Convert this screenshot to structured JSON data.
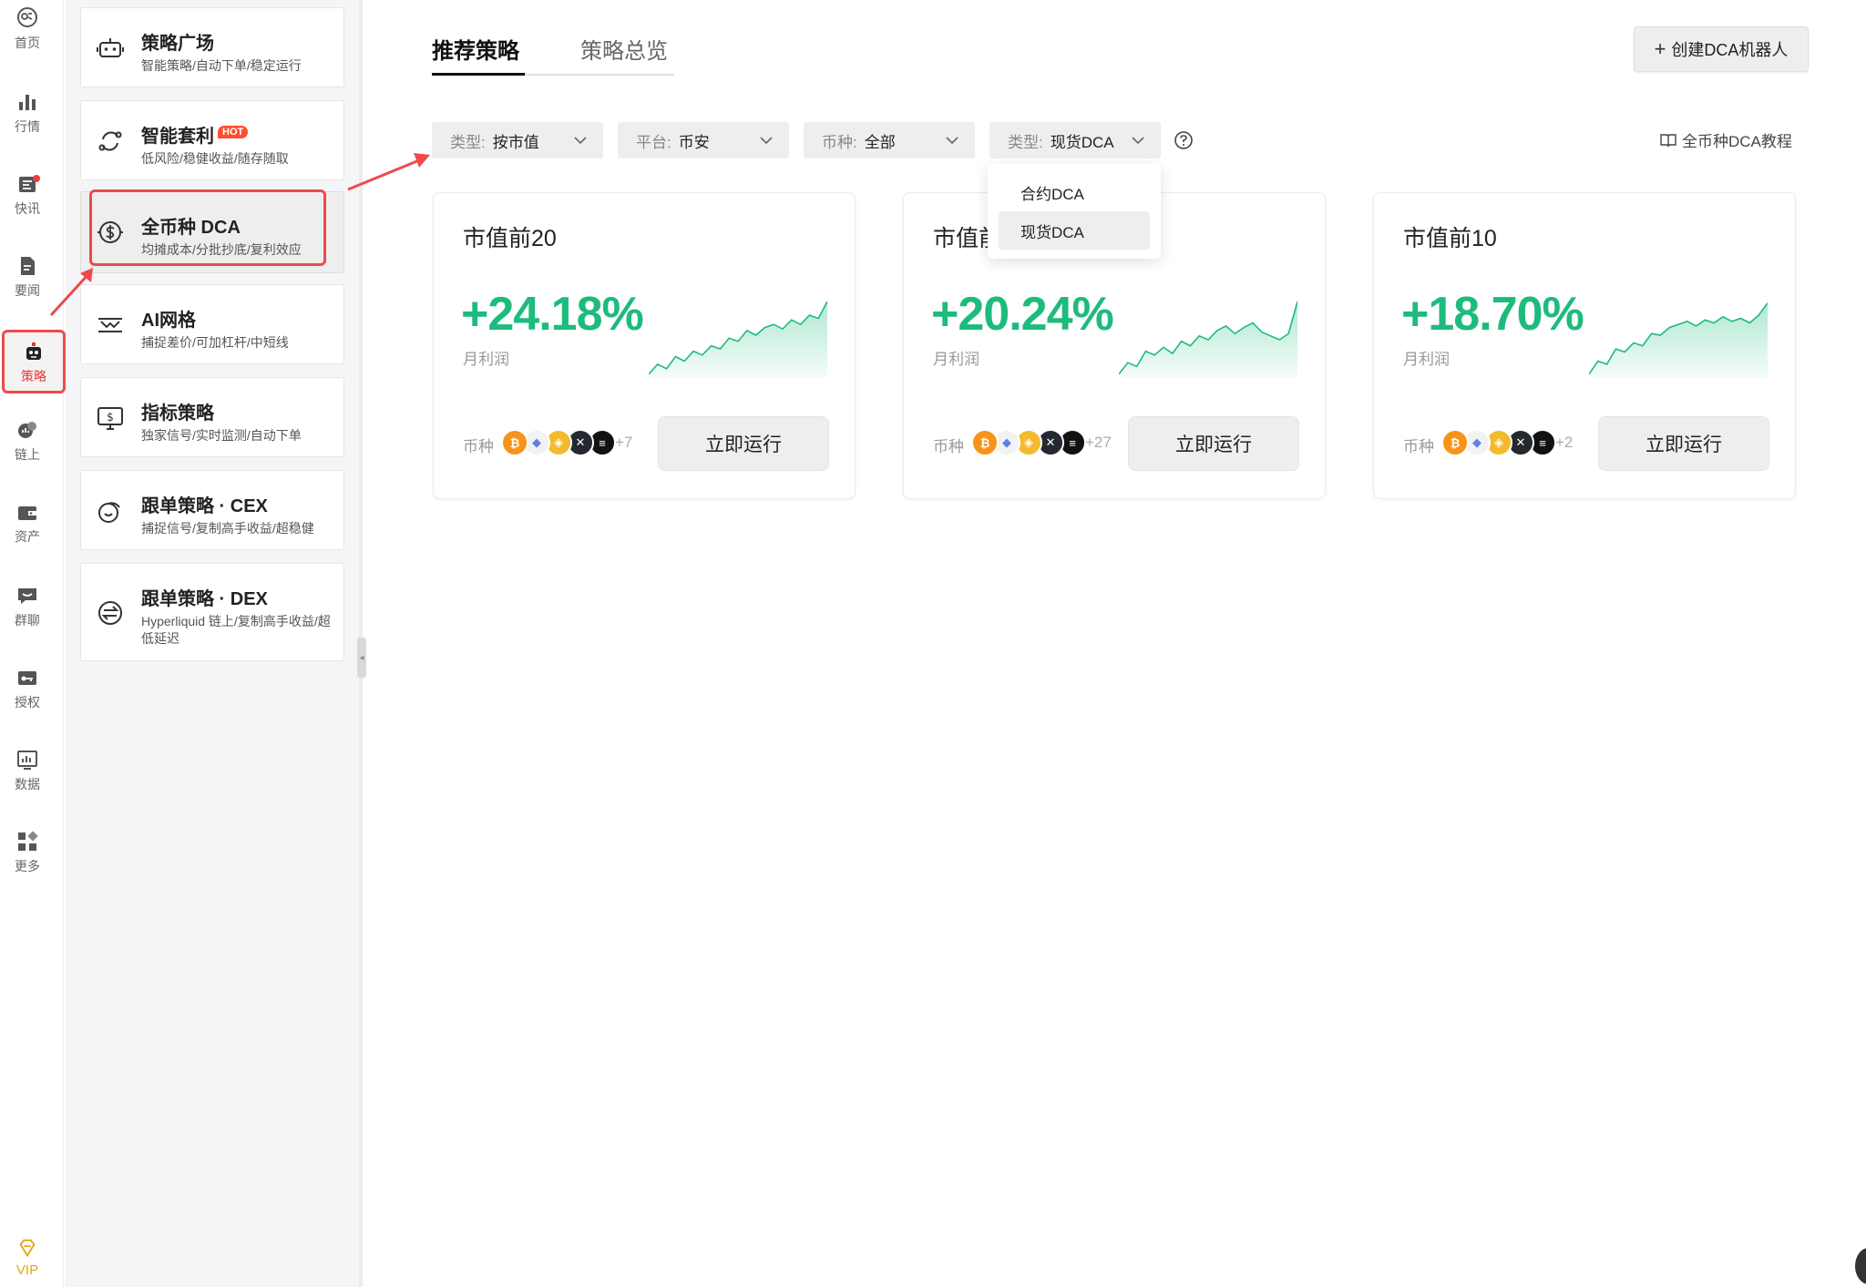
{
  "rail": {
    "items": [
      {
        "label": "首页",
        "icon": "home-icon"
      },
      {
        "label": "行情",
        "icon": "bar-chart-icon"
      },
      {
        "label": "快讯",
        "icon": "news-flash-icon"
      },
      {
        "label": "要闻",
        "icon": "document-icon"
      },
      {
        "label": "策略",
        "icon": "robot-icon"
      },
      {
        "label": "链上",
        "icon": "chain-icon"
      },
      {
        "label": "资产",
        "icon": "wallet-icon"
      },
      {
        "label": "群聊",
        "icon": "chat-icon"
      },
      {
        "label": "授权",
        "icon": "key-icon"
      },
      {
        "label": "数据",
        "icon": "data-icon"
      },
      {
        "label": "更多",
        "icon": "grid-icon"
      }
    ],
    "vip_label": "VIP",
    "active_index": 4
  },
  "strategies": [
    {
      "title": "策略广场",
      "subtitle": "智能策略/自动下单/稳定运行",
      "icon": "robot-icon"
    },
    {
      "title": "智能套利",
      "badge": "HOT",
      "subtitle": "低风险/稳健收益/随存随取",
      "icon": "loop-icon"
    },
    {
      "title": "全币种 DCA",
      "subtitle": "均摊成本/分批抄底/复利效应",
      "icon": "dca-icon"
    },
    {
      "title": "AI网格",
      "subtitle": "捕捉差价/可加杠杆/中短线",
      "icon": "grid-trade-icon"
    },
    {
      "title": "指标策略",
      "subtitle": "独家信号/实时监测/自动下单",
      "icon": "indicator-icon"
    },
    {
      "title": "跟单策略 · CEX",
      "subtitle": "捕捉信号/复制高手收益/超稳健",
      "icon": "copy-cex-icon"
    },
    {
      "title": "跟单策略 · DEX",
      "subtitle": "Hyperliquid 链上/复制高手收益/超低延迟",
      "icon": "copy-dex-icon"
    }
  ],
  "tabs": [
    {
      "label": "推荐策略",
      "active": true
    },
    {
      "label": "策略总览",
      "active": false
    }
  ],
  "create_button": "创建DCA机器人",
  "filters": [
    {
      "label": "类型:",
      "value": "按市值"
    },
    {
      "label": "平台:",
      "value": "币安"
    },
    {
      "label": "币种:",
      "value": "全部"
    },
    {
      "label": "类型:",
      "value": "现货DCA"
    }
  ],
  "tutorial_link": "全币种DCA教程",
  "dropdown": {
    "options": [
      "合约DCA",
      "现货DCA"
    ],
    "selected": "现货DCA"
  },
  "cards": [
    {
      "title": "市值前20",
      "profit": "+24.18%",
      "profit_label": "月利润",
      "coin_label": "币种",
      "more": "+7",
      "button": "立即运行",
      "spark": [
        0.05,
        0.18,
        0.12,
        0.28,
        0.22,
        0.35,
        0.3,
        0.42,
        0.38,
        0.52,
        0.48,
        0.62,
        0.56,
        0.66,
        0.7,
        0.64,
        0.76,
        0.7,
        0.82,
        0.78,
        1.0
      ]
    },
    {
      "title": "市值前",
      "profit": "+20.24%",
      "profit_label": "月利润",
      "coin_label": "币种",
      "more": "+27",
      "button": "立即运行",
      "spark": [
        0.05,
        0.2,
        0.15,
        0.35,
        0.3,
        0.4,
        0.32,
        0.48,
        0.42,
        0.55,
        0.5,
        0.62,
        0.68,
        0.58,
        0.66,
        0.72,
        0.6,
        0.55,
        0.5,
        0.58,
        1.0
      ]
    },
    {
      "title": "市值前10",
      "profit": "+18.70%",
      "profit_label": "月利润",
      "coin_label": "币种",
      "more": "+2",
      "button": "立即运行",
      "spark": [
        0.05,
        0.22,
        0.18,
        0.38,
        0.34,
        0.46,
        0.42,
        0.58,
        0.56,
        0.66,
        0.7,
        0.74,
        0.68,
        0.76,
        0.72,
        0.8,
        0.74,
        0.78,
        0.72,
        0.82,
        0.98
      ]
    }
  ],
  "coins": [
    {
      "name": "BTC",
      "symbol": "₿",
      "color": "#f7931a"
    },
    {
      "name": "ETH",
      "symbol": "◆",
      "color": "#f2f2f2"
    },
    {
      "name": "BNB",
      "symbol": "◈",
      "color": "#f3ba2f"
    },
    {
      "name": "XRP",
      "symbol": "✕",
      "color": "#23292f"
    },
    {
      "name": "SOL",
      "symbol": "≡",
      "color": "#111111"
    }
  ],
  "colors": {
    "accent_green": "#1dbb7c",
    "highlight_red": "#ef4a4a",
    "hot_badge": "#ff4d2e",
    "vip_gold": "#e5a512"
  }
}
